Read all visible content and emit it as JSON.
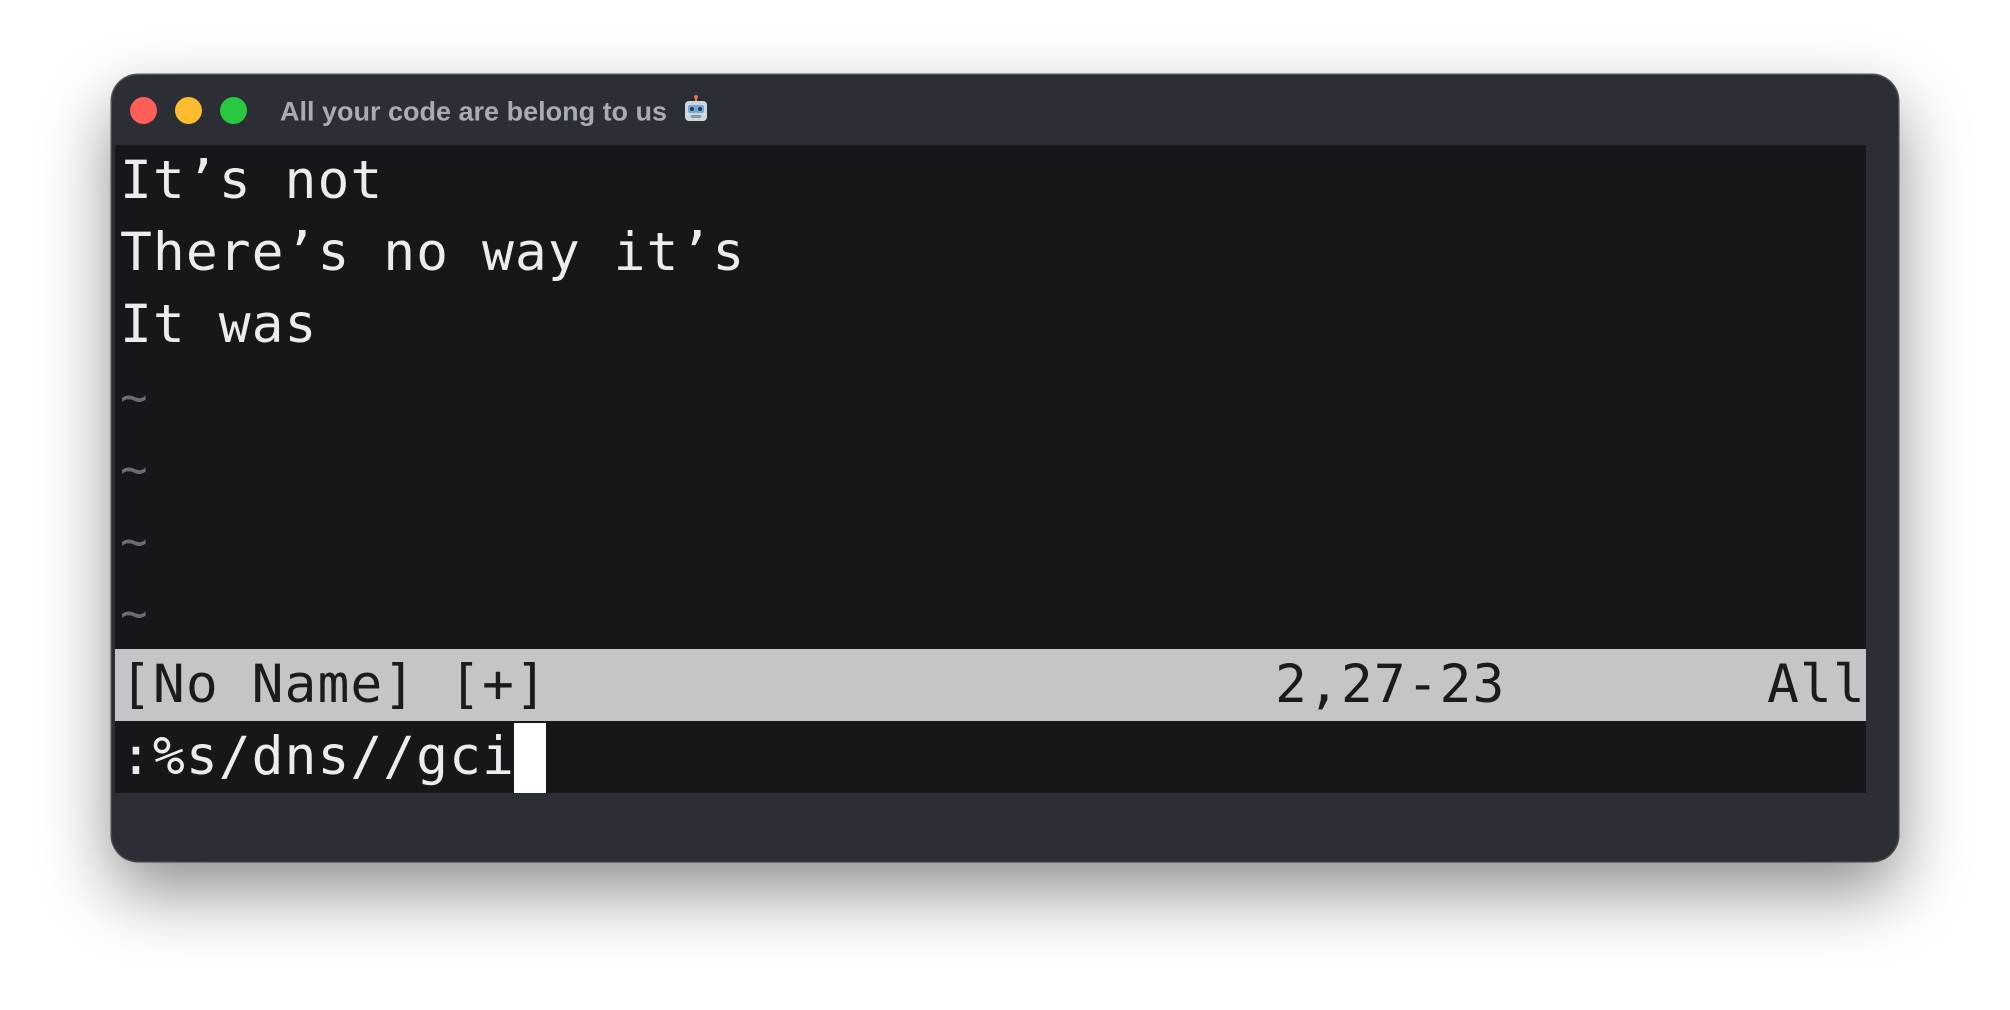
{
  "window": {
    "title": "All your code are belong to us"
  },
  "buffer": {
    "lines": [
      "It’s not",
      "There’s no way it’s",
      "It was"
    ],
    "empty_markers": [
      "~",
      "~",
      "~",
      "~"
    ]
  },
  "statusline": {
    "filename": "[No Name] [+]",
    "position": "2,27-23",
    "scroll": "All"
  },
  "cmdline": {
    "text": ":%s/dns//gci"
  },
  "colors": {
    "background": "#16171b",
    "text": "#ececec",
    "statusline_bg": "#c4c5c9",
    "close": "#ff5f57",
    "minimize": "#febc2e",
    "zoom": "#28c840"
  }
}
